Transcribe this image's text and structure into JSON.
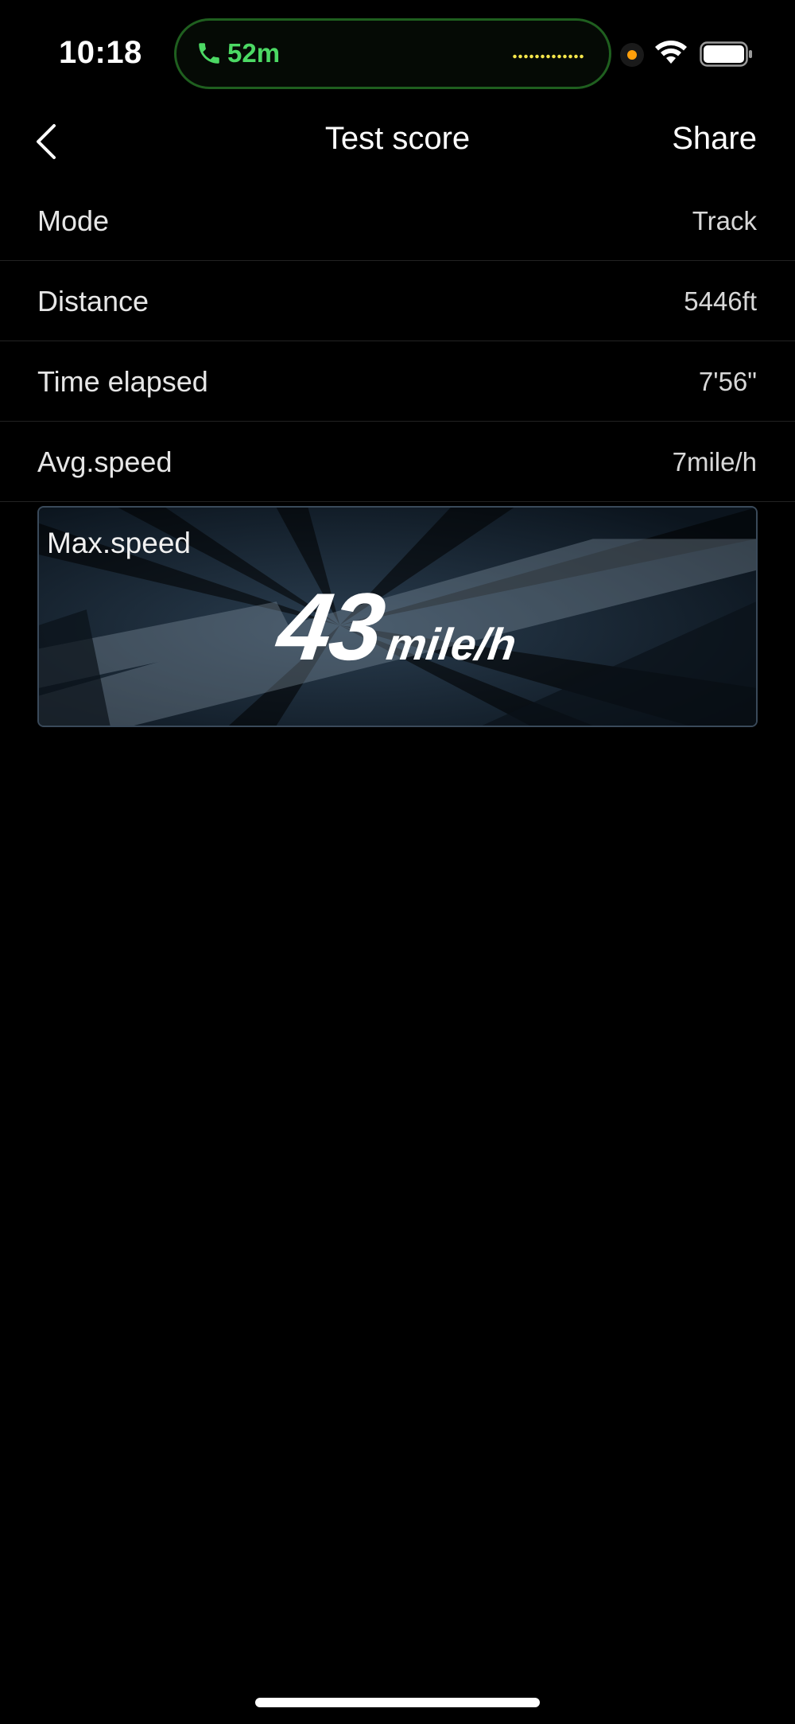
{
  "status_bar": {
    "time": "10:18",
    "call_duration": "52m",
    "call_color": "#4cd964",
    "privacy_dot_color": "#ff9f0a",
    "icons": [
      "phone-icon",
      "waveform-icon",
      "wifi-icon",
      "battery-icon"
    ]
  },
  "nav": {
    "back_icon": "chevron-left-icon",
    "title": "Test score",
    "share_label": "Share"
  },
  "stats": [
    {
      "label": "Mode",
      "value": "Track"
    },
    {
      "label": "Distance",
      "value": "5446ft"
    },
    {
      "label": "Time elapsed",
      "value": "7'56\""
    },
    {
      "label": "Avg.speed",
      "value": "7mile/h"
    }
  ],
  "max_speed": {
    "label": "Max.speed",
    "value": "43",
    "unit": "mile/h"
  }
}
